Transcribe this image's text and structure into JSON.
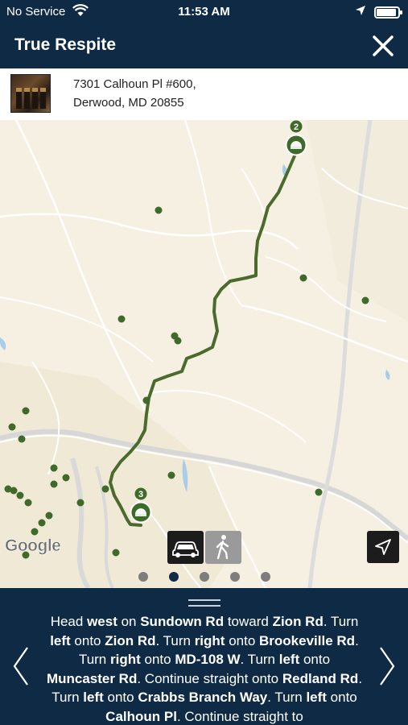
{
  "status": {
    "carrier": "No Service",
    "time": "11:53 AM",
    "battery_level": 0.92,
    "icons": [
      "wifi-icon",
      "location-arrow-icon",
      "battery-icon"
    ]
  },
  "header": {
    "title": "True Respite",
    "close_icon": "close-icon"
  },
  "location": {
    "address_line1": "7301 Calhoun Pl #600,",
    "address_line2": "Derwood, MD 20855"
  },
  "map": {
    "attribution": "Google",
    "route_color": "#4a6b2c",
    "marker_color": "#3f6a2a",
    "markers": [
      {
        "number": "2",
        "name": "route-start-marker"
      },
      {
        "number": "3",
        "name": "route-end-marker"
      }
    ],
    "travel_modes": [
      {
        "name": "car-mode-button",
        "icon": "car-icon",
        "selected": true
      },
      {
        "name": "walk-mode-button",
        "icon": "walking-person-icon",
        "selected": false
      }
    ],
    "locate_icon": "navigation-arrow-icon",
    "page_dots": {
      "count": 5,
      "active_index": 1
    }
  },
  "directions": {
    "segments": [
      {
        "text": "Head ",
        "bold": false
      },
      {
        "text": "west",
        "bold": true
      },
      {
        "text": " on ",
        "bold": false
      },
      {
        "text": "Sundown Rd",
        "bold": true
      },
      {
        "text": " toward ",
        "bold": false
      },
      {
        "text": "Zion Rd",
        "bold": true
      },
      {
        "text": ". Turn ",
        "bold": false
      },
      {
        "text": "left",
        "bold": true
      },
      {
        "text": " onto ",
        "bold": false
      },
      {
        "text": "Zion Rd",
        "bold": true
      },
      {
        "text": ". Turn ",
        "bold": false
      },
      {
        "text": "right",
        "bold": true
      },
      {
        "text": " onto ",
        "bold": false
      },
      {
        "text": "Brookeville Rd",
        "bold": true
      },
      {
        "text": ". Turn ",
        "bold": false
      },
      {
        "text": "right",
        "bold": true
      },
      {
        "text": " onto ",
        "bold": false
      },
      {
        "text": "MD-108 W",
        "bold": true
      },
      {
        "text": ". Turn ",
        "bold": false
      },
      {
        "text": "left",
        "bold": true
      },
      {
        "text": " onto ",
        "bold": false
      },
      {
        "text": "Muncaster Rd",
        "bold": true
      },
      {
        "text": ". Continue straight onto ",
        "bold": false
      },
      {
        "text": "Redland Rd",
        "bold": true
      },
      {
        "text": ". Turn ",
        "bold": false
      },
      {
        "text": "left",
        "bold": true
      },
      {
        "text": " onto ",
        "bold": false
      },
      {
        "text": "Crabbs Branch Way",
        "bold": true
      },
      {
        "text": ". Turn ",
        "bold": false
      },
      {
        "text": "left",
        "bold": true
      },
      {
        "text": " onto ",
        "bold": false
      },
      {
        "text": "Calhoun Pl",
        "bold": true
      },
      {
        "text": ". Continue straight to",
        "bold": false
      }
    ],
    "prev_icon": "chevron-left-icon",
    "next_icon": "chevron-right-icon"
  }
}
